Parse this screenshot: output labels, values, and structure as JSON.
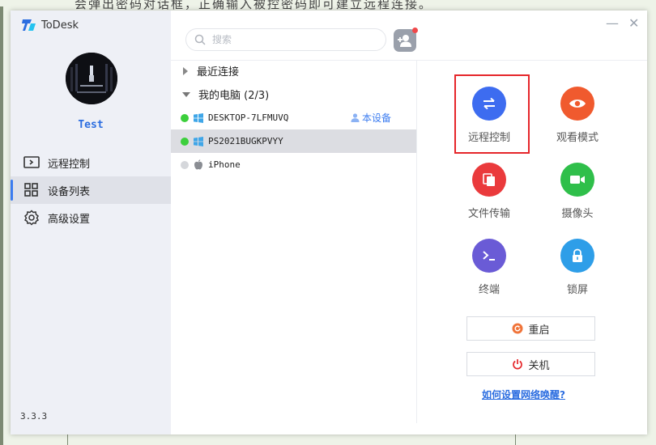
{
  "background": {
    "doc_text": "会弹出密码对话框，正确输入被控密码即可建立远程连接。"
  },
  "app": {
    "name": "ToDesk",
    "version": "3.3.3",
    "username": "Test"
  },
  "window_controls": {
    "minimize": "—",
    "close": "✕"
  },
  "sidebar": {
    "items": [
      {
        "label": "远程控制",
        "icon": "remote-screen-icon",
        "active": false
      },
      {
        "label": "设备列表",
        "icon": "grid-icon",
        "active": true
      },
      {
        "label": "高级设置",
        "icon": "gear-icon",
        "active": false
      }
    ]
  },
  "search": {
    "placeholder": "搜索"
  },
  "device_list": {
    "recent_label": "最近连接",
    "my_computers_label": "我的电脑 (2/3)",
    "this_device_label": "本设备",
    "devices": [
      {
        "name": "DESKTOP-7LFMUVQ",
        "status": "online",
        "os": "windows",
        "this_device": true,
        "selected": false
      },
      {
        "name": "PS2021BUGKPVYY",
        "status": "online",
        "os": "windows",
        "this_device": false,
        "selected": true
      },
      {
        "name": "iPhone",
        "status": "offline",
        "os": "apple",
        "this_device": false,
        "selected": false
      }
    ]
  },
  "features": [
    {
      "label": "远程控制",
      "icon": "transfer-arrows-icon",
      "color": "#3d6cf0"
    },
    {
      "label": "观看模式",
      "icon": "eye-icon",
      "color": "#f05a2e"
    },
    {
      "label": "文件传输",
      "icon": "files-icon",
      "color": "#ea3a3c"
    },
    {
      "label": "摄像头",
      "icon": "camera-icon",
      "color": "#2fbf4a"
    },
    {
      "label": "终端",
      "icon": "terminal-icon",
      "color": "#6a5bd6"
    },
    {
      "label": "锁屏",
      "icon": "lock-icon",
      "color": "#2e9ee8"
    }
  ],
  "actions": {
    "restart_label": "重启",
    "shutdown_label": "关机",
    "wake_link": "如何设置网络唤醒?"
  },
  "colors": {
    "accent": "#3b7cf0",
    "online": "#3ccf3c",
    "offline": "#d5d7db",
    "highlight_box": "#e5262a"
  }
}
